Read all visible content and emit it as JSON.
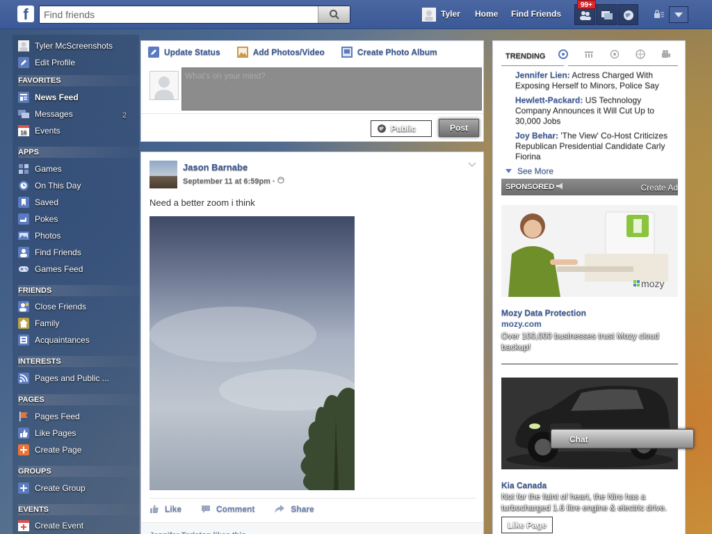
{
  "topbar": {
    "logo": "f",
    "search_placeholder": "Find friends",
    "user_name": "Tyler",
    "home_label": "Home",
    "find_friends_label": "Find Friends",
    "notification_count": "99+"
  },
  "left_nav": {
    "profile_name": "Tyler McScreenshots",
    "edit_profile": "Edit Profile",
    "favorites_head": "FAVORITES",
    "news_feed": "News Feed",
    "messages": "Messages",
    "messages_count": "2",
    "events": "Events",
    "events_icon_num": "16",
    "apps_head": "APPS",
    "games": "Games",
    "on_this_day": "On This Day",
    "saved": "Saved",
    "pokes": "Pokes",
    "photos": "Photos",
    "find_friends": "Find Friends",
    "games_feed": "Games Feed",
    "friends_head": "FRIENDS",
    "close_friends": "Close Friends",
    "family": "Family",
    "acquaintances": "Acquaintances",
    "interests_head": "INTERESTS",
    "pages_public": "Pages and Public ...",
    "pages_head": "PAGES",
    "pages_feed": "Pages Feed",
    "like_pages": "Like Pages",
    "create_page": "Create Page",
    "groups_head": "GROUPS",
    "create_group": "Create Group",
    "events_head": "EVENTS",
    "create_event": "Create Event"
  },
  "composer": {
    "update_status": "Update Status",
    "add_photos": "Add Photos/Video",
    "create_album": "Create Photo Album",
    "placeholder": "What's on your mind?",
    "audience": "Public",
    "post": "Post"
  },
  "story": {
    "author": "Jason Barnabe",
    "timestamp": "September 11 at 6:59pm ·",
    "text": "Need a better zoom i think",
    "like": "Like",
    "comment": "Comment",
    "share": "Share",
    "likes_line": "Jennifer Tarleton likes this."
  },
  "right": {
    "trending_title": "TRENDING",
    "trends": [
      {
        "name": "Jennifer Lien:",
        "text": " Actress Charged With Exposing Herself to Minors, Police Say"
      },
      {
        "name": "Hewlett-Packard:",
        "text": " US Technology Company Announces it Will Cut Up to 30,000 Jobs"
      },
      {
        "name": "Joy Behar:",
        "text": " 'The View' Co-Host Criticizes Republican Presidential Candidate Carly Fiorina"
      }
    ],
    "see_more": "See More",
    "sponsored": "SPONSORED",
    "create_ad": "Create Ad",
    "ads": [
      {
        "brand": "mozy",
        "title": "Mozy Data Protection",
        "domain": "mozy.com",
        "body": "Over 100,000 businesses trust Mozy cloud backup!"
      },
      {
        "title": "Kia Canada",
        "body": "Not for the faint of heart, the Niro has a turbocharged 1.6 litre engine & electric drive.",
        "cta": "Like Page"
      }
    ]
  },
  "chat": {
    "label": "Chat"
  },
  "colors": {
    "brand": "#3b5998",
    "badge": "#e0262c"
  }
}
